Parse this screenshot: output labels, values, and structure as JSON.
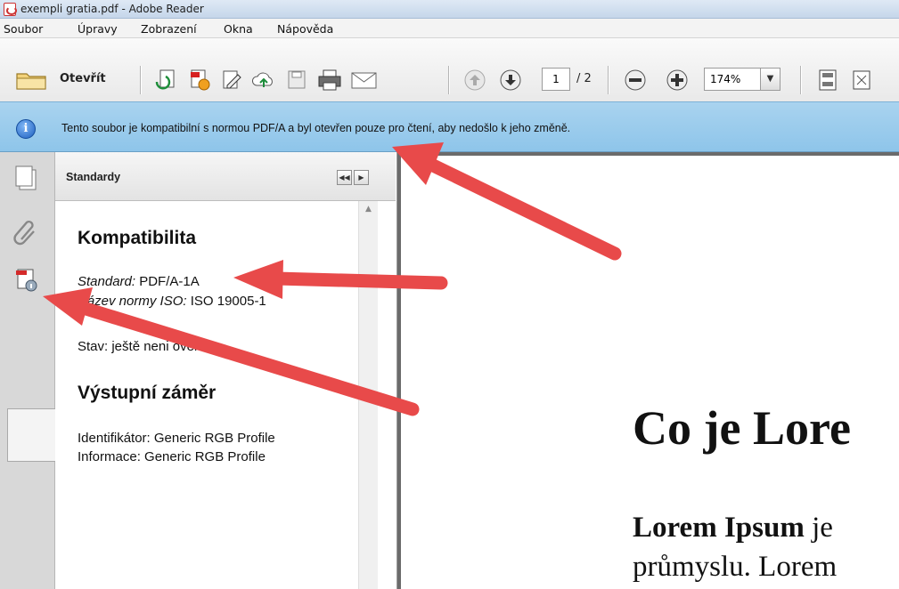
{
  "window": {
    "title": "exempli gratia.pdf - Adobe Reader"
  },
  "menu": {
    "items": [
      "Soubor",
      "Úpravy",
      "Zobrazení",
      "Okna",
      "Nápověda"
    ]
  },
  "toolbar": {
    "open_label": "Otevřít",
    "page_current": "1",
    "page_total": "/ 2",
    "zoom": "174%"
  },
  "infobar": {
    "message": "Tento soubor je kompatibilní s normou PDF/A a byl otevřen pouze pro čtení, aby nedošlo k jeho změně."
  },
  "panel": {
    "title": "Standardy",
    "section1": {
      "heading": "Kompatibilita",
      "standard_label": "Standard:",
      "standard_value": "PDF/A-1A",
      "iso_label": "Název normy ISO:",
      "iso_value": "ISO 19005-1",
      "status": "Stav: ještě neni ověřen"
    },
    "section2": {
      "heading": "Výstupní záměr",
      "identifier": "Identifikátor: Generic RGB Profile",
      "info": "Informace: Generic RGB Profile"
    }
  },
  "document": {
    "title": "Co je Lore",
    "line1_bold": "Lorem Ipsum",
    "line1_rest": " je",
    "line2": "průmyslu. Lorem"
  },
  "colors": {
    "infobar": "#9dccee",
    "annotation_arrow": "#e84a4a"
  }
}
